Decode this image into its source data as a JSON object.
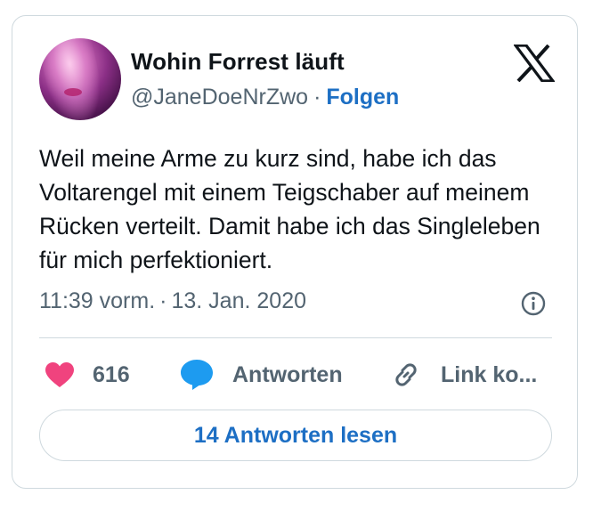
{
  "author": {
    "display_name": "Wohin Forrest läuft",
    "handle": "@JaneDoeNrZwo",
    "separator": "·",
    "follow_label": "Folgen"
  },
  "tweet": {
    "text": "Weil meine Arme zu kurz sind, habe ich das Voltarengel mit einem Teigschaber auf meinem Rücken verteilt. Damit habe ich das Singleleben für mich perfektioniert.",
    "time": "11:39 vorm.",
    "separator": "·",
    "date": "13. Jan. 2020"
  },
  "actions": {
    "like_count": "616",
    "reply_label": "Antworten",
    "link_label": "Link ko..."
  },
  "read_replies_label": "14 Antworten lesen",
  "icons": {
    "brand": "x-logo-icon",
    "info": "info-icon",
    "like": "heart-icon",
    "reply": "speech-bubble-icon",
    "link": "link-icon"
  },
  "colors": {
    "heart": "#f0437e",
    "reply_bubble": "#1d9bf0",
    "link_blue": "#1d6fc4",
    "secondary_text": "#536471",
    "border": "#cfd9de"
  }
}
